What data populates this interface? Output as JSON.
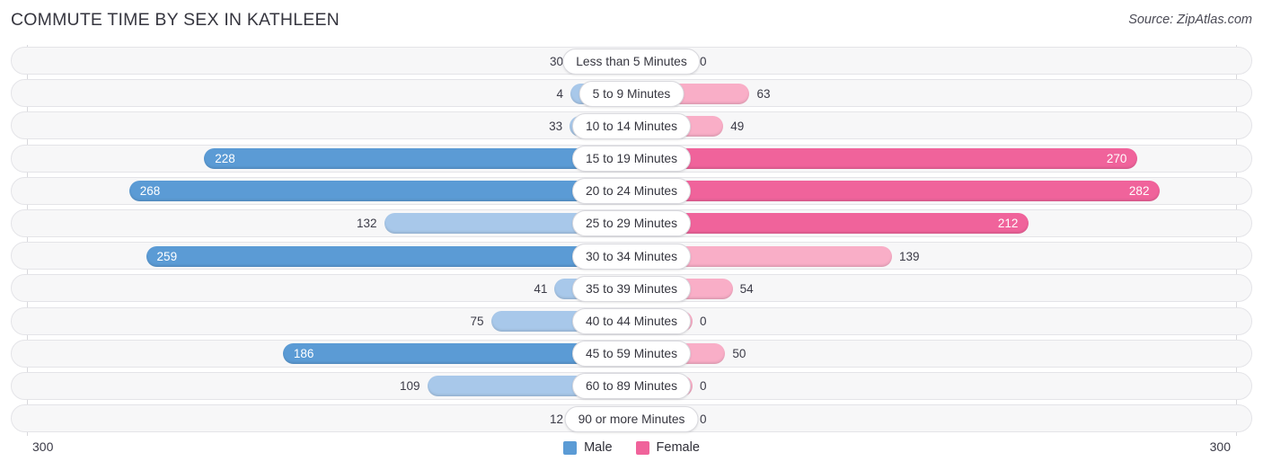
{
  "header": {
    "title": "COMMUTE TIME BY SEX IN KATHLEEN",
    "source": "Source: ZipAtlas.com"
  },
  "axis": {
    "left_label": "300",
    "right_label": "300"
  },
  "legend": {
    "items": [
      {
        "label": "Male",
        "color": "#5b9bd5"
      },
      {
        "label": "Female",
        "color": "#f0639b"
      }
    ]
  },
  "colors": {
    "male_strong": "#5b9bd5",
    "male_light": "#a8c8ea",
    "female_strong": "#f0639b",
    "female_light": "#f9aec7",
    "track": "#f7f7f8",
    "track_border": "#e4e4e8",
    "gridline": "#d8d8dc"
  },
  "chart_data": {
    "type": "bar",
    "title": "COMMUTE TIME BY SEX IN KATHLEEN",
    "subtitle": "",
    "orientation": "horizontal-diverging",
    "xlabel": "",
    "ylabel": "",
    "xlim": [
      300,
      300
    ],
    "axis_max": 300,
    "grid": false,
    "legend_position": "bottom-center",
    "categories": [
      "Less than 5 Minutes",
      "5 to 9 Minutes",
      "10 to 14 Minutes",
      "15 to 19 Minutes",
      "20 to 24 Minutes",
      "25 to 29 Minutes",
      "30 to 34 Minutes",
      "35 to 39 Minutes",
      "40 to 44 Minutes",
      "45 to 59 Minutes",
      "60 to 89 Minutes",
      "90 or more Minutes"
    ],
    "series": [
      {
        "name": "Male",
        "values": [
          30,
          4,
          33,
          228,
          268,
          132,
          259,
          41,
          75,
          186,
          109,
          12
        ]
      },
      {
        "name": "Female",
        "values": [
          0,
          63,
          49,
          270,
          282,
          212,
          139,
          54,
          0,
          50,
          0,
          0
        ]
      }
    ]
  },
  "rows": [
    {
      "label": "Less than 5 Minutes",
      "male": "30",
      "female": "0"
    },
    {
      "label": "5 to 9 Minutes",
      "male": "4",
      "female": "63"
    },
    {
      "label": "10 to 14 Minutes",
      "male": "33",
      "female": "49"
    },
    {
      "label": "15 to 19 Minutes",
      "male": "228",
      "female": "270"
    },
    {
      "label": "20 to 24 Minutes",
      "male": "268",
      "female": "282"
    },
    {
      "label": "25 to 29 Minutes",
      "male": "132",
      "female": "212"
    },
    {
      "label": "30 to 34 Minutes",
      "male": "259",
      "female": "139"
    },
    {
      "label": "35 to 39 Minutes",
      "male": "41",
      "female": "54"
    },
    {
      "label": "40 to 44 Minutes",
      "male": "75",
      "female": "0"
    },
    {
      "label": "45 to 59 Minutes",
      "male": "186",
      "female": "50"
    },
    {
      "label": "60 to 89 Minutes",
      "male": "109",
      "female": "0"
    },
    {
      "label": "90 or more Minutes",
      "male": "12",
      "female": "0"
    }
  ]
}
